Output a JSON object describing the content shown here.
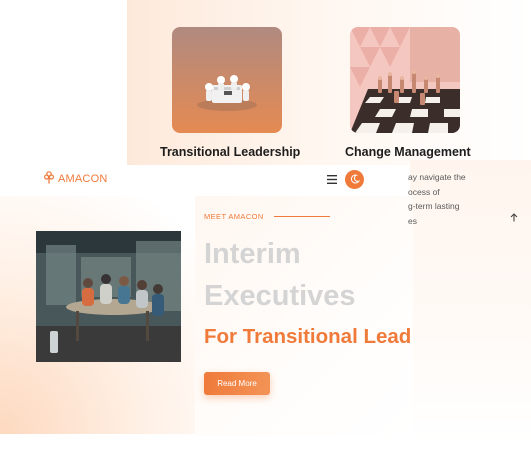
{
  "services": [
    {
      "title": "Transitional Leadership",
      "image": "leadership-figures-photo"
    },
    {
      "title": "Change Management",
      "image": "chessboard-photo"
    }
  ],
  "header": {
    "logo_text": "AMACON",
    "logo_icon": "tree-icon",
    "menu_icon": "hamburger-menu-icon",
    "theme_icon": "moon-icon"
  },
  "side_text_lines": [
    "ay navigate the",
    "ocess of",
    "g-term lasting",
    "es"
  ],
  "scroll_icon": "arrow-up-icon",
  "hero": {
    "eyebrow": "MEET AMACON",
    "title_line1": "Interim",
    "title_line2": "Executives",
    "subtitle": "For Transitional Lead",
    "button_label": "Read More",
    "image": "office-meeting-photo"
  },
  "colors": {
    "accent": "#ef7a3a",
    "heading_dark": "#1d1d1d",
    "hero_title": "#d4d4d4",
    "body_text": "#5a5a5a"
  }
}
